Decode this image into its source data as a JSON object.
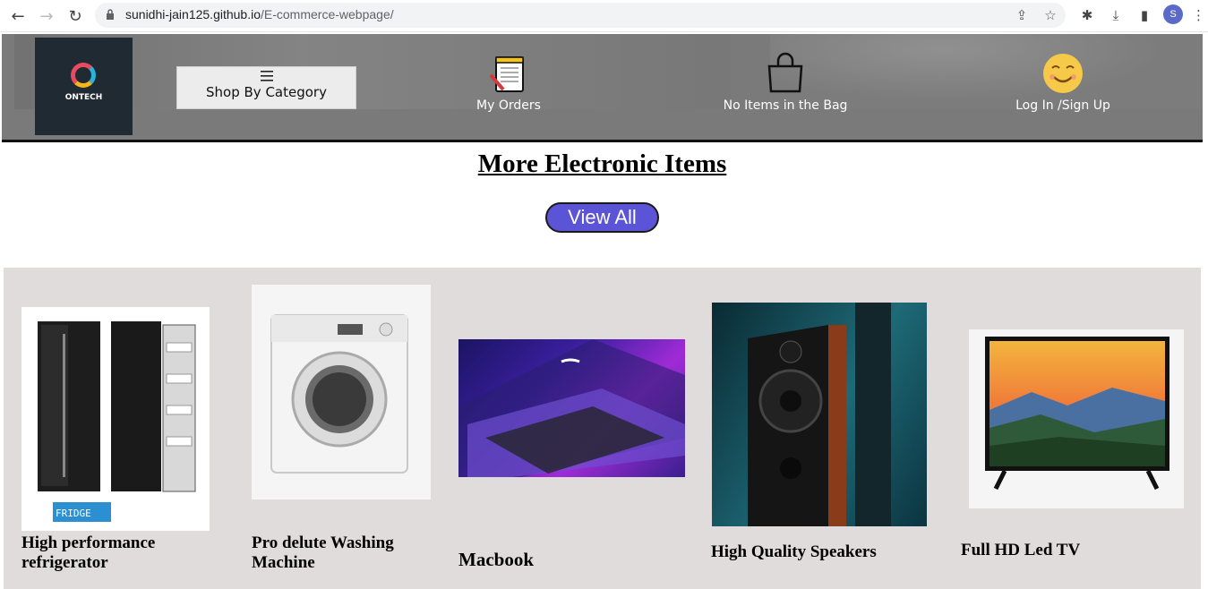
{
  "browser": {
    "url_host": "sunidhi-jain125.github.io",
    "url_path": "/E-commerce-webpage/",
    "profile_initial": "S"
  },
  "header": {
    "logo_text": "ONTECH",
    "category_label": "Shop By Category",
    "orders_label": "My Orders",
    "bag_label": "No Items in the Bag",
    "login_label": "Log In /Sign Up"
  },
  "section": {
    "title": "More Electronic Items",
    "view_all_label": "View All"
  },
  "products": [
    {
      "name": "High performance refrigerator",
      "icon": "refrigerator-image"
    },
    {
      "name": "Pro delute Washing Machine",
      "icon": "washing-machine-image"
    },
    {
      "name": "Macbook",
      "icon": "macbook-image"
    },
    {
      "name": "High Quality Speakers",
      "icon": "speakers-image"
    },
    {
      "name": "Full HD Led TV",
      "icon": "tv-image"
    }
  ],
  "colors": {
    "header_bg": "#7a7a7a",
    "view_all_bg": "#5b54d6",
    "products_bg": "#e0dcdb"
  }
}
